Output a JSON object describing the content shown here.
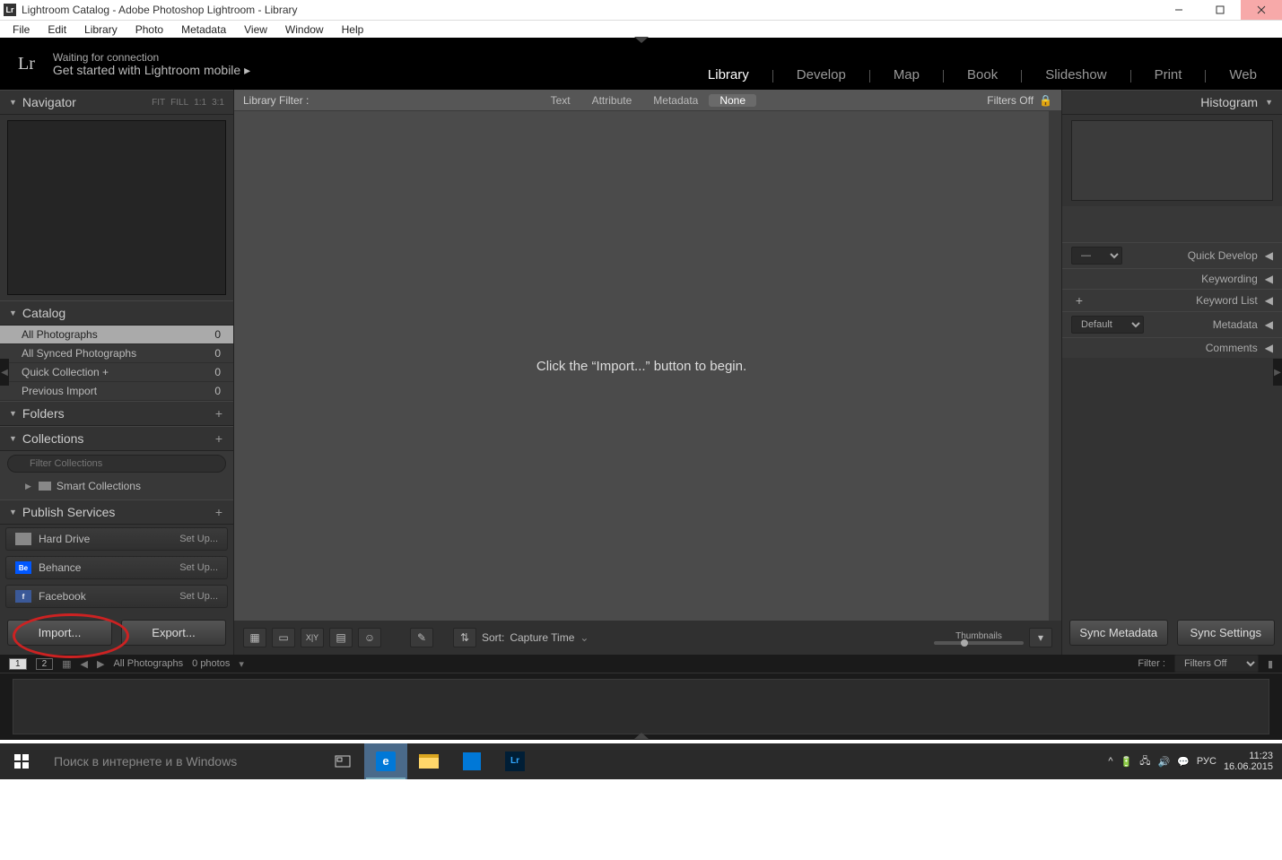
{
  "window": {
    "title": "Lightroom Catalog - Adobe Photoshop Lightroom - Library",
    "lr_icon": "Lr"
  },
  "menubar": [
    "File",
    "Edit",
    "Library",
    "Photo",
    "Metadata",
    "View",
    "Window",
    "Help"
  ],
  "header": {
    "logo": "Lr",
    "status": "Waiting for connection",
    "sub": "Get started with Lightroom mobile  ▸",
    "modules": [
      "Library",
      "Develop",
      "Map",
      "Book",
      "Slideshow",
      "Print",
      "Web"
    ],
    "active_module": "Library"
  },
  "left": {
    "navigator": {
      "title": "Navigator",
      "opts": [
        "FIT",
        "FILL",
        "1:1",
        "3:1"
      ]
    },
    "catalog": {
      "title": "Catalog",
      "items": [
        {
          "label": "All Photographs",
          "count": "0",
          "selected": true
        },
        {
          "label": "All Synced Photographs",
          "count": "0"
        },
        {
          "label": "Quick Collection  +",
          "count": "0"
        },
        {
          "label": "Previous Import",
          "count": "0"
        }
      ]
    },
    "folders": {
      "title": "Folders"
    },
    "collections": {
      "title": "Collections",
      "filter_placeholder": "Filter Collections",
      "smart": "Smart Collections"
    },
    "publish": {
      "title": "Publish Services",
      "items": [
        {
          "label": "Hard Drive",
          "setup": "Set Up...",
          "icon_bg": "#888",
          "icon_txt": ""
        },
        {
          "label": "Behance",
          "setup": "Set Up...",
          "icon_bg": "#0057ff",
          "icon_txt": "Be"
        },
        {
          "label": "Facebook",
          "setup": "Set Up...",
          "icon_bg": "#3b5998",
          "icon_txt": "f"
        }
      ]
    },
    "import_btn": "Import...",
    "export_btn": "Export..."
  },
  "center": {
    "filter_label": "Library Filter :",
    "filter_tabs": [
      "Text",
      "Attribute",
      "Metadata",
      "None"
    ],
    "filter_active": "None",
    "filters_off": "Filters Off",
    "empty_msg": "Click the “Import...” button to begin.",
    "toolbar": {
      "sort_label": "Sort:",
      "sort_value": "Capture Time",
      "thumb_label": "Thumbnails"
    }
  },
  "right": {
    "histogram": "Histogram",
    "quick_dev": "Quick Develop",
    "keywording": "Keywording",
    "keyword_list": "Keyword List",
    "metadata": "Metadata",
    "metadata_preset": "Default",
    "comments": "Comments",
    "sync_meta": "Sync Metadata",
    "sync_settings": "Sync Settings"
  },
  "filmstrip": {
    "breadcrumb": "All Photographs",
    "count": "0 photos",
    "filter_label": "Filter :",
    "filter_value": "Filters Off"
  },
  "taskbar": {
    "search_placeholder": "Поиск в интернете и в Windows",
    "lang": "РУС",
    "time": "11:23",
    "date": "16.06.2015"
  }
}
